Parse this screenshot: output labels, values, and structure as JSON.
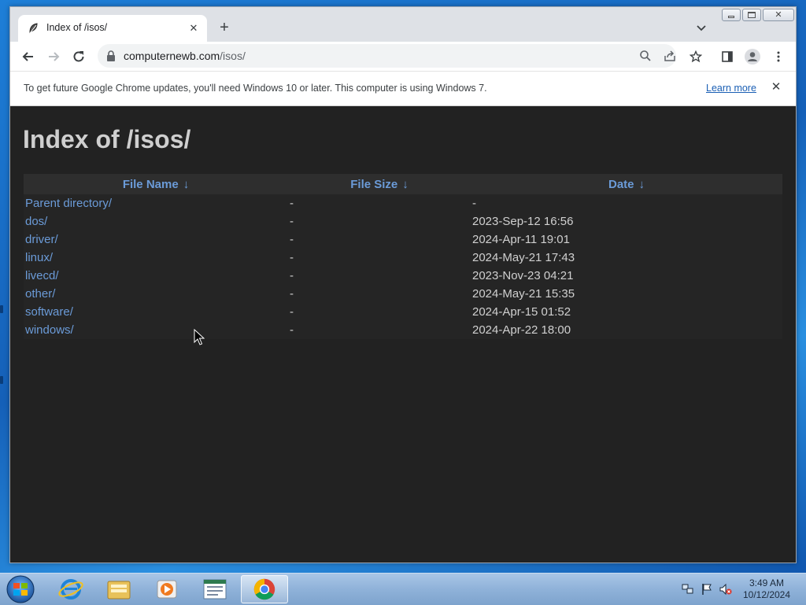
{
  "browser": {
    "tab": {
      "title": "Index of /isos/",
      "favicon": "apache-feather-icon"
    },
    "url": {
      "domain": "computernewb.com",
      "path": "/isos/"
    },
    "infobar": {
      "message": "To get future Google Chrome updates, you'll need Windows 10 or later. This computer is using Windows 7.",
      "link": "Learn more"
    }
  },
  "page": {
    "heading": "Index of /isos/",
    "columns": [
      {
        "label": "File Name",
        "sort": "↓"
      },
      {
        "label": "File Size",
        "sort": "↓"
      },
      {
        "label": "Date",
        "sort": "↓"
      }
    ],
    "rows": [
      {
        "name": "Parent directory/",
        "size": "-",
        "date": "-"
      },
      {
        "name": "dos/",
        "size": "-",
        "date": "2023-Sep-12 16:56"
      },
      {
        "name": "driver/",
        "size": "-",
        "date": "2024-Apr-11 19:01"
      },
      {
        "name": "linux/",
        "size": "-",
        "date": "2024-May-21 17:43"
      },
      {
        "name": "livecd/",
        "size": "-",
        "date": "2023-Nov-23 04:21"
      },
      {
        "name": "other/",
        "size": "-",
        "date": "2024-May-21 15:35"
      },
      {
        "name": "software/",
        "size": "-",
        "date": "2024-Apr-15 01:52"
      },
      {
        "name": "windows/",
        "size": "-",
        "date": "2024-Apr-22 18:00"
      }
    ]
  },
  "taskbar": {
    "apps": [
      "internet-explorer-icon",
      "file-explorer-icon",
      "media-player-icon",
      "notepad-icon",
      "chrome-icon"
    ],
    "clock": {
      "time": "3:49 AM",
      "date": "10/12/2024"
    }
  }
}
